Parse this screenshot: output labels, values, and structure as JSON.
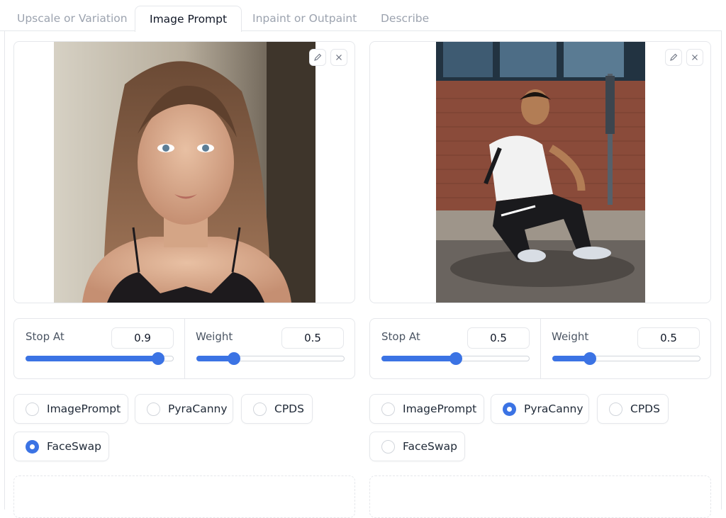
{
  "tabs": [
    {
      "label": "Upscale or Variation",
      "active": false
    },
    {
      "label": "Image Prompt",
      "active": true
    },
    {
      "label": "Inpaint or Outpaint",
      "active": false
    },
    {
      "label": "Describe",
      "active": false
    }
  ],
  "panels": [
    {
      "stop_at": {
        "label": "Stop At",
        "value": "0.9",
        "fraction": 0.9
      },
      "weight": {
        "label": "Weight",
        "value": "0.5",
        "fraction": 0.25
      },
      "options": [
        {
          "label": "ImagePrompt",
          "checked": false
        },
        {
          "label": "PyraCanny",
          "checked": false
        },
        {
          "label": "CPDS",
          "checked": false
        },
        {
          "label": "FaceSwap",
          "checked": true
        }
      ]
    },
    {
      "stop_at": {
        "label": "Stop At",
        "value": "0.5",
        "fraction": 0.5
      },
      "weight": {
        "label": "Weight",
        "value": "0.5",
        "fraction": 0.25
      },
      "options": [
        {
          "label": "ImagePrompt",
          "checked": false
        },
        {
          "label": "PyraCanny",
          "checked": true
        },
        {
          "label": "CPDS",
          "checked": false
        },
        {
          "label": "FaceSwap",
          "checked": false
        }
      ]
    }
  ],
  "icons": {
    "edit": "pencil-icon",
    "clear": "close-icon"
  },
  "colors": {
    "accent": "#3b73e4",
    "border": "#e5e7eb",
    "inactive_tab": "#9ca3af"
  }
}
